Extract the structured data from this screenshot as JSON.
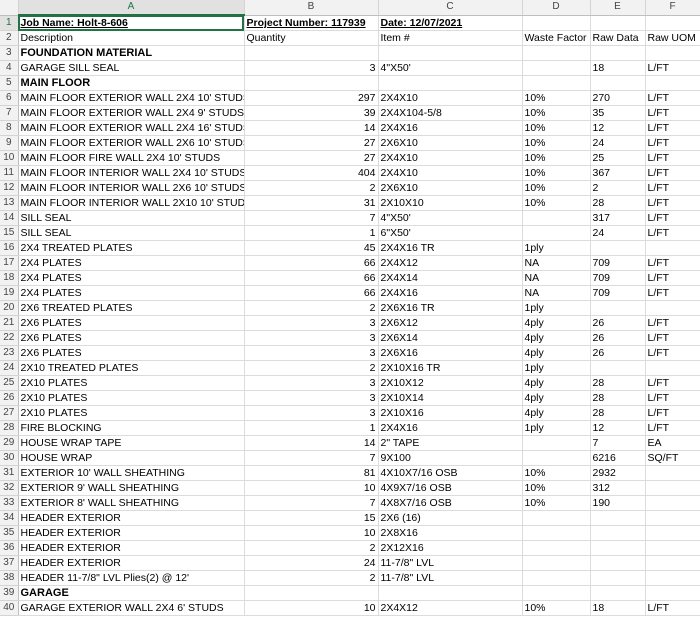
{
  "columns": [
    "A",
    "B",
    "C",
    "D",
    "E",
    "F"
  ],
  "rows": [
    {
      "n": "1",
      "a": "Job Name: Holt-8-606",
      "b": "Project Number: 117939",
      "bnum": "",
      "c": "Date: 12/07/2021",
      "d": "",
      "e": "",
      "f": ""
    },
    {
      "n": "2",
      "a": "Description",
      "b": "Quantity",
      "bnum": "",
      "c": "Item #",
      "d": "Waste Factor",
      "e": "Raw Data",
      "f": "Raw UOM"
    },
    {
      "n": "3",
      "a": "FOUNDATION MATERIAL",
      "b": "",
      "bnum": "",
      "c": "",
      "d": "",
      "e": "",
      "f": ""
    },
    {
      "n": "4",
      "a": "GARAGE SILL SEAL",
      "b": "",
      "bnum": "3",
      "c": "4\"X50'",
      "d": "",
      "e": "18",
      "f": "L/FT"
    },
    {
      "n": "5",
      "a": "MAIN FLOOR",
      "b": "",
      "bnum": "",
      "c": "",
      "d": "",
      "e": "",
      "f": ""
    },
    {
      "n": "6",
      "a": "MAIN FLOOR EXTERIOR WALL 2X4 10' STUDS",
      "b": "",
      "bnum": "297",
      "c": "2X4X10",
      "d": "10%",
      "e": "270",
      "f": "L/FT"
    },
    {
      "n": "7",
      "a": "MAIN FLOOR EXTERIOR WALL 2X4 9' STUDS",
      "b": "",
      "bnum": "39",
      "c": "2X4X104-5/8",
      "d": "10%",
      "e": "35",
      "f": "L/FT"
    },
    {
      "n": "8",
      "a": "MAIN FLOOR EXTERIOR WALL 2X4 16' STUDS",
      "b": "",
      "bnum": "14",
      "c": "2X4X16",
      "d": "10%",
      "e": "12",
      "f": "L/FT"
    },
    {
      "n": "9",
      "a": "MAIN FLOOR EXTERIOR WALL 2X6 10' STUDS",
      "b": "",
      "bnum": "27",
      "c": "2X6X10",
      "d": "10%",
      "e": "24",
      "f": "L/FT"
    },
    {
      "n": "10",
      "a": "MAIN FLOOR FIRE WALL 2X4 10' STUDS",
      "b": "",
      "bnum": "27",
      "c": "2X4X10",
      "d": "10%",
      "e": "25",
      "f": "L/FT"
    },
    {
      "n": "11",
      "a": "MAIN FLOOR INTERIOR WALL 2X4 10' STUDS",
      "b": "",
      "bnum": "404",
      "c": "2X4X10",
      "d": "10%",
      "e": "367",
      "f": "L/FT"
    },
    {
      "n": "12",
      "a": "MAIN FLOOR INTERIOR WALL 2X6 10' STUDS",
      "b": "",
      "bnum": "2",
      "c": "2X6X10",
      "d": "10%",
      "e": "2",
      "f": "L/FT"
    },
    {
      "n": "13",
      "a": "MAIN FLOOR INTERIOR WALL 2X10 10' STUDS",
      "b": "",
      "bnum": "31",
      "c": "2X10X10",
      "d": "10%",
      "e": "28",
      "f": "L/FT"
    },
    {
      "n": "14",
      "a": "SILL SEAL",
      "b": "",
      "bnum": "7",
      "c": "4\"X50'",
      "d": "",
      "e": "317",
      "f": "L/FT"
    },
    {
      "n": "15",
      "a": "SILL SEAL",
      "b": "",
      "bnum": "1",
      "c": "6\"X50'",
      "d": "",
      "e": "24",
      "f": "L/FT"
    },
    {
      "n": "16",
      "a": "2X4 TREATED PLATES",
      "b": "",
      "bnum": "45",
      "c": "2X4X16 TR",
      "d": "1ply",
      "e": "",
      "f": ""
    },
    {
      "n": "17",
      "a": "2X4 PLATES",
      "b": "",
      "bnum": "66",
      "c": "2X4X12",
      "d": "NA",
      "e": "709",
      "f": "L/FT"
    },
    {
      "n": "18",
      "a": "2X4 PLATES",
      "b": "",
      "bnum": "66",
      "c": "2X4X14",
      "d": "NA",
      "e": "709",
      "f": "L/FT"
    },
    {
      "n": "19",
      "a": "2X4 PLATES",
      "b": "",
      "bnum": "66",
      "c": "2X4X16",
      "d": "NA",
      "e": "709",
      "f": "L/FT"
    },
    {
      "n": "20",
      "a": "2X6 TREATED PLATES",
      "b": "",
      "bnum": "2",
      "c": "2X6X16 TR",
      "d": "1ply",
      "e": "",
      "f": ""
    },
    {
      "n": "21",
      "a": "2X6 PLATES",
      "b": "",
      "bnum": "3",
      "c": "2X6X12",
      "d": "4ply",
      "e": "26",
      "f": "L/FT"
    },
    {
      "n": "22",
      "a": "2X6 PLATES",
      "b": "",
      "bnum": "3",
      "c": "2X6X14",
      "d": "4ply",
      "e": "26",
      "f": "L/FT"
    },
    {
      "n": "23",
      "a": "2X6 PLATES",
      "b": "",
      "bnum": "3",
      "c": "2X6X16",
      "d": "4ply",
      "e": "26",
      "f": "L/FT"
    },
    {
      "n": "24",
      "a": "2X10 TREATED PLATES",
      "b": "",
      "bnum": "2",
      "c": "2X10X16 TR",
      "d": "1ply",
      "e": "",
      "f": ""
    },
    {
      "n": "25",
      "a": "2X10 PLATES",
      "b": "",
      "bnum": "3",
      "c": "2X10X12",
      "d": "4ply",
      "e": "28",
      "f": "L/FT"
    },
    {
      "n": "26",
      "a": "2X10 PLATES",
      "b": "",
      "bnum": "3",
      "c": "2X10X14",
      "d": "4ply",
      "e": "28",
      "f": "L/FT"
    },
    {
      "n": "27",
      "a": "2X10 PLATES",
      "b": "",
      "bnum": "3",
      "c": "2X10X16",
      "d": "4ply",
      "e": "28",
      "f": "L/FT"
    },
    {
      "n": "28",
      "a": "FIRE BLOCKING",
      "b": "",
      "bnum": "1",
      "c": "2X4X16",
      "d": "1ply",
      "e": "12",
      "f": "L/FT"
    },
    {
      "n": "29",
      "a": "HOUSE WRAP TAPE",
      "b": "",
      "bnum": "14",
      "c": "2\" TAPE",
      "d": "",
      "e": "7",
      "f": "EA"
    },
    {
      "n": "30",
      "a": "HOUSE WRAP",
      "b": "",
      "bnum": "7",
      "c": "9X100",
      "d": "",
      "e": "6216",
      "f": "SQ/FT"
    },
    {
      "n": "31",
      "a": "EXTERIOR 10' WALL SHEATHING",
      "b": "",
      "bnum": "81",
      "c": "4X10X7/16 OSB",
      "d": "10%",
      "e": "2932",
      "f": ""
    },
    {
      "n": "32",
      "a": "EXTERIOR 9' WALL SHEATHING",
      "b": "",
      "bnum": "10",
      "c": "4X9X7/16 OSB",
      "d": "10%",
      "e": "312",
      "f": ""
    },
    {
      "n": "33",
      "a": "EXTERIOR 8' WALL SHEATHING",
      "b": "",
      "bnum": "7",
      "c": "4X8X7/16 OSB",
      "d": "10%",
      "e": "190",
      "f": ""
    },
    {
      "n": "34",
      "a": "HEADER EXTERIOR",
      "b": "",
      "bnum": "15",
      "c": "2X6 (16)",
      "d": "",
      "e": "",
      "f": ""
    },
    {
      "n": "35",
      "a": "HEADER EXTERIOR",
      "b": "",
      "bnum": "10",
      "c": "2X8X16",
      "d": "",
      "e": "",
      "f": ""
    },
    {
      "n": "36",
      "a": "HEADER EXTERIOR",
      "b": "",
      "bnum": "2",
      "c": "2X12X16",
      "d": "",
      "e": "",
      "f": ""
    },
    {
      "n": "37",
      "a": "HEADER EXTERIOR",
      "b": "",
      "bnum": "24",
      "c": "11-7/8\" LVL",
      "d": "",
      "e": "",
      "f": ""
    },
    {
      "n": "38",
      "a": "HEADER 11-7/8\" LVL Plies(2) @ 12'",
      "b": "",
      "bnum": "2",
      "c": "11-7/8\" LVL",
      "d": "",
      "e": "",
      "f": ""
    },
    {
      "n": "39",
      "a": "GARAGE",
      "b": "",
      "bnum": "",
      "c": "",
      "d": "",
      "e": "",
      "f": ""
    },
    {
      "n": "40",
      "a": "GARAGE EXTERIOR WALL 2X4 6' STUDS",
      "b": "",
      "bnum": "10",
      "c": "2X4X12",
      "d": "10%",
      "e": "18",
      "f": "L/FT"
    }
  ]
}
